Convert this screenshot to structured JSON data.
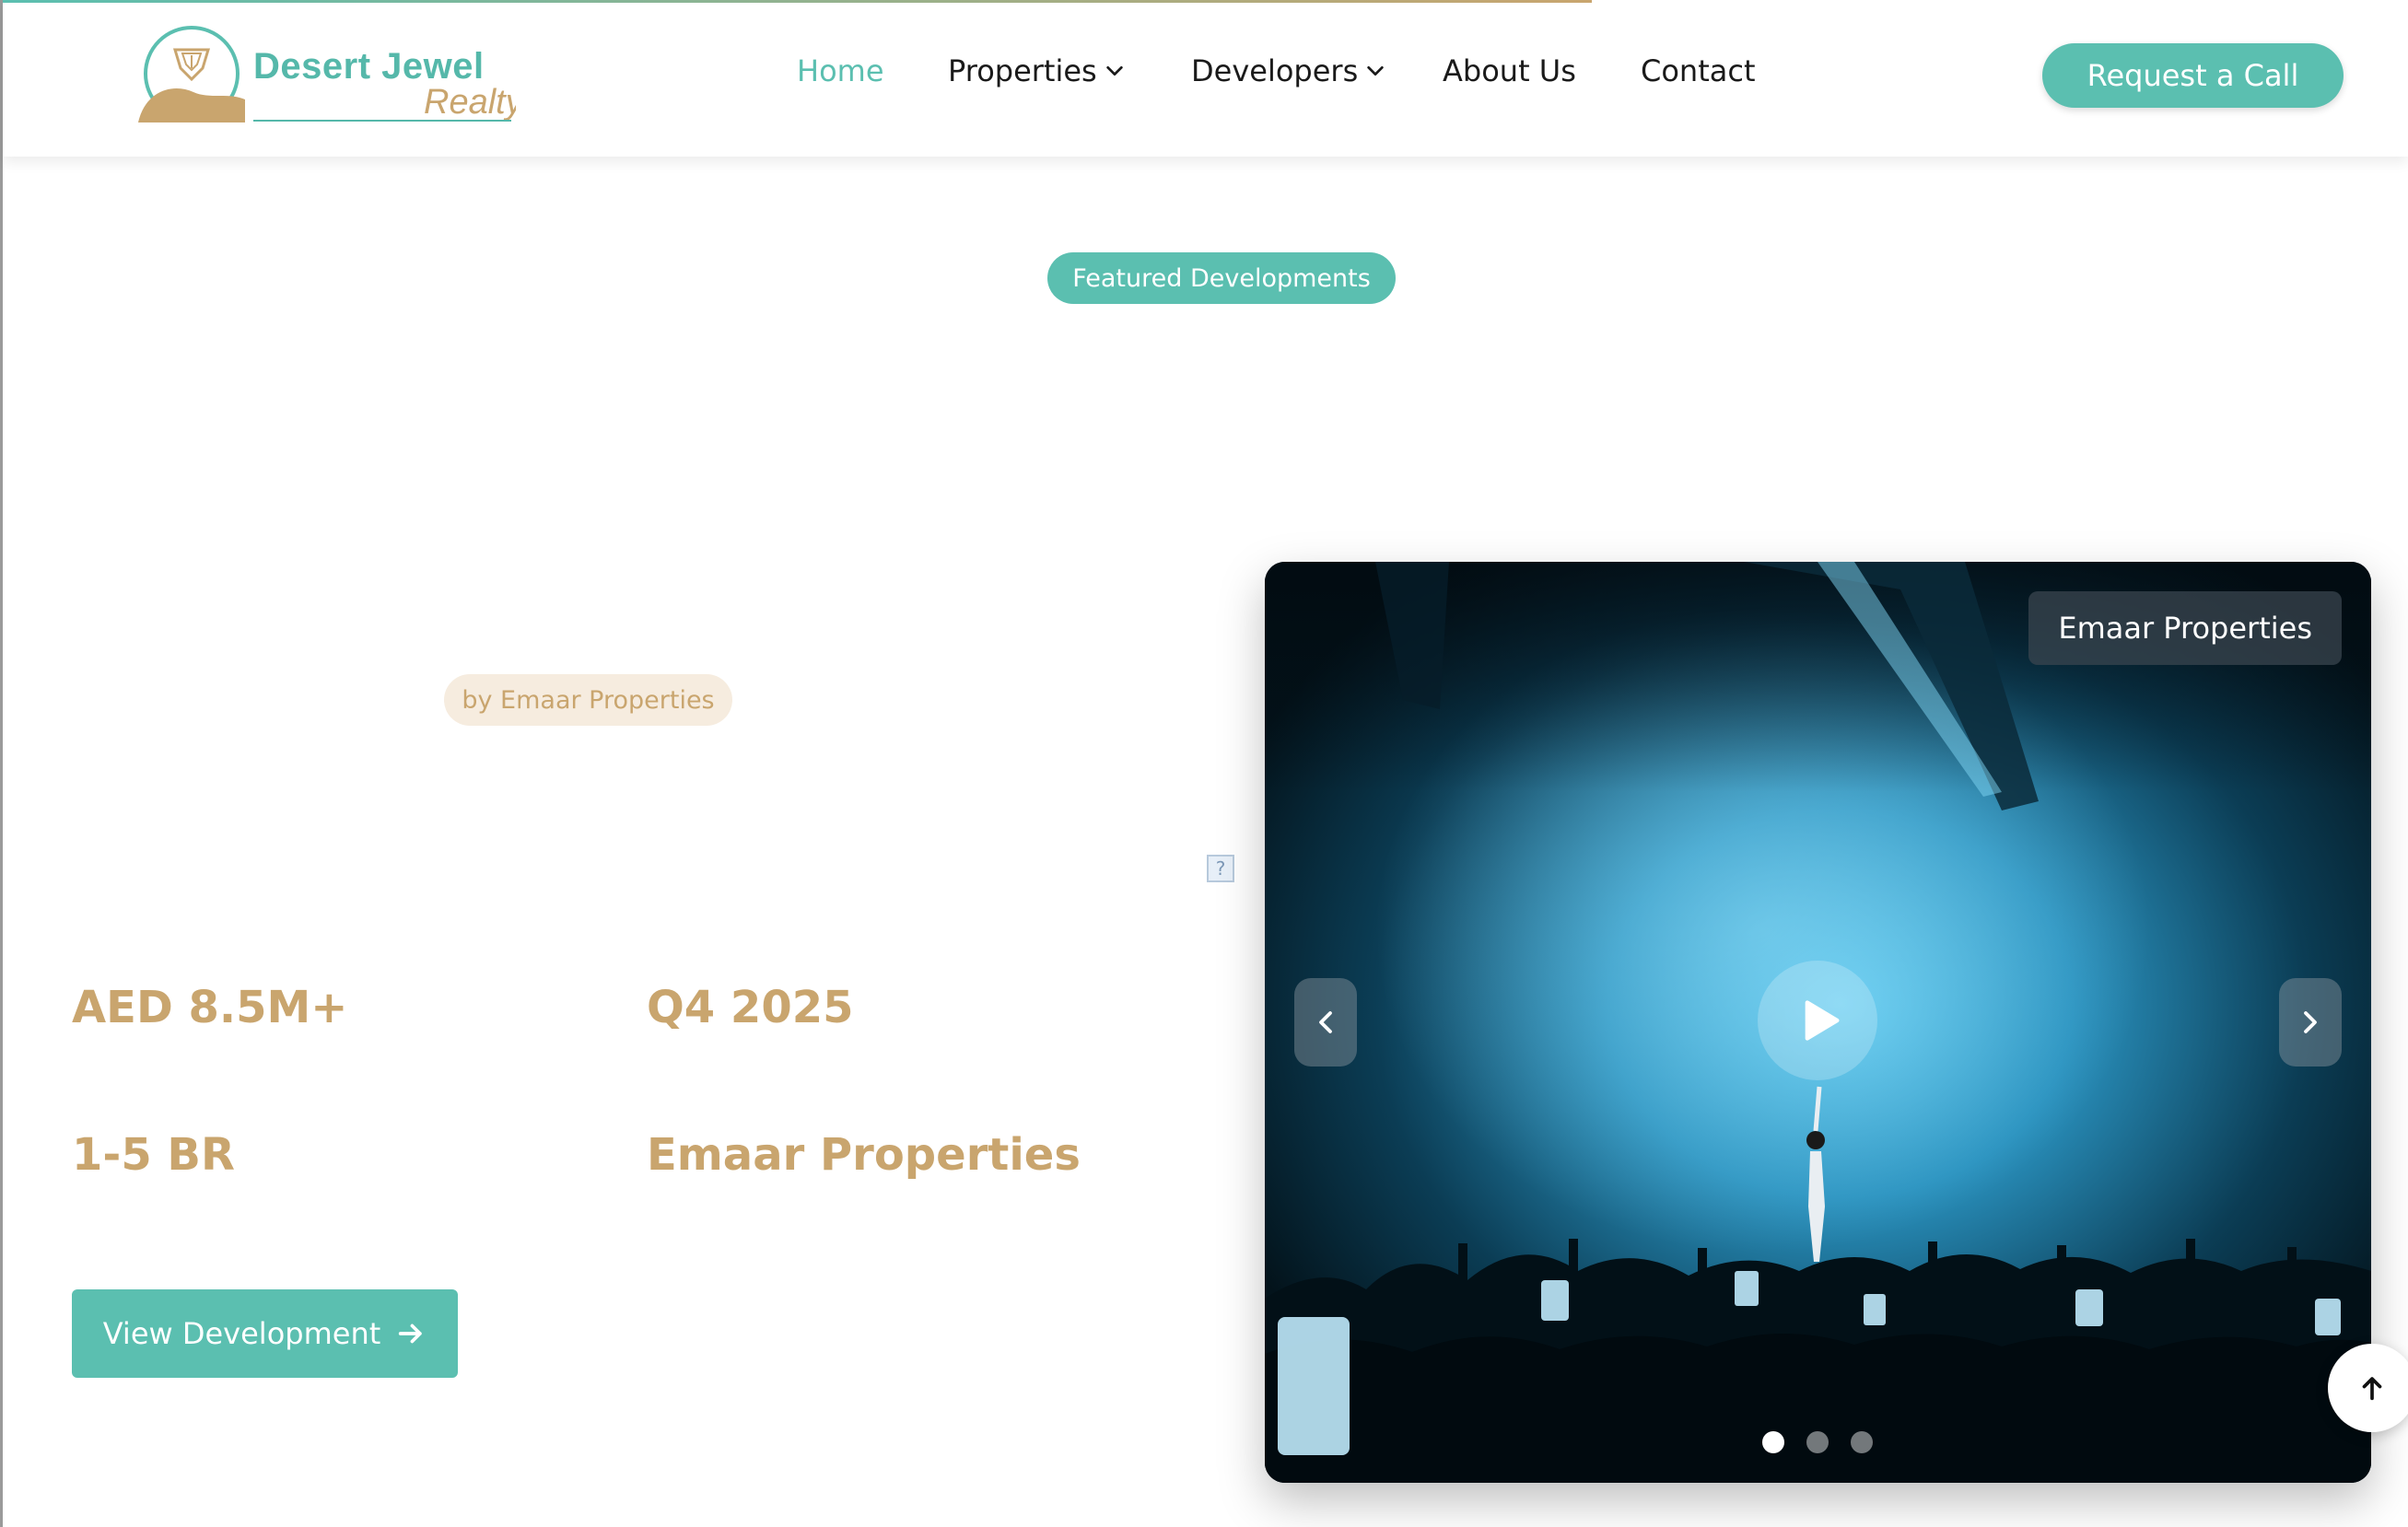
{
  "brand": {
    "name": "Desert Jewel",
    "tagline": "Realty",
    "colors": {
      "teal": "#5bbfb0",
      "gold": "#c9a56e"
    }
  },
  "nav": {
    "items": [
      {
        "label": "Home",
        "active": true,
        "has_dropdown": false
      },
      {
        "label": "Properties",
        "active": false,
        "has_dropdown": true
      },
      {
        "label": "Developers",
        "active": false,
        "has_dropdown": true
      },
      {
        "label": "About Us",
        "active": false,
        "has_dropdown": false
      },
      {
        "label": "Contact",
        "active": false,
        "has_dropdown": false
      }
    ],
    "cta_label": "Request a Call"
  },
  "section": {
    "badge": "Featured Developments"
  },
  "development": {
    "developer_pill": "by Emaar Properties",
    "stats": {
      "price": "AED 8.5M+",
      "completion": "Q4 2025",
      "bedrooms": "1-5 BR",
      "developer": "Emaar Properties"
    },
    "view_button": "View Development",
    "broken_image_glyph": "?"
  },
  "media": {
    "badge": "Emaar Properties",
    "slides": 3,
    "active_slide": 1,
    "icons": [
      "chevron-left-icon",
      "chevron-right-icon",
      "play-icon",
      "arrow-up-icon",
      "arrow-right-icon"
    ]
  }
}
